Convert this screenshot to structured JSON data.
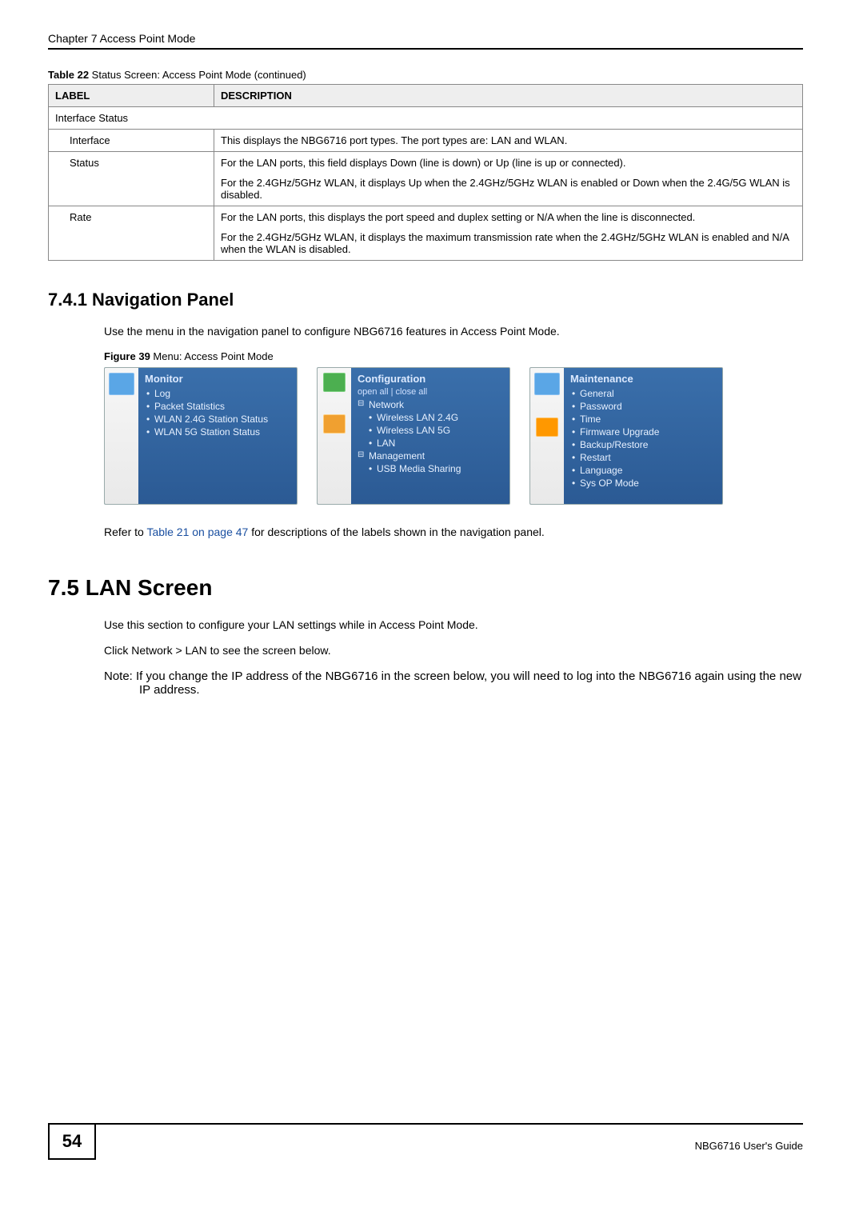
{
  "header": {
    "chapter": "Chapter 7 Access Point Mode"
  },
  "table": {
    "caption_prefix": "Table 22",
    "caption_rest": "   Status Screen: Access Point Mode (continued)",
    "col_label": "LABEL",
    "col_desc": "DESCRIPTION",
    "rows": {
      "interface_status": "Interface Status",
      "interface_label": "Interface",
      "interface_desc": "This displays the NBG6716 port types. The port types are: LAN and WLAN.",
      "status_label": "Status",
      "status_desc_p1": "For the LAN ports, this field displays Down (line is down) or Up (line is up or connected).",
      "status_desc_p2": "For the 2.4GHz/5GHz WLAN, it displays Up when the 2.4GHz/5GHz WLAN is enabled or Down when the 2.4G/5G WLAN is disabled.",
      "rate_label": "Rate",
      "rate_desc_p1": "For the LAN ports, this displays the port speed and duplex setting or N/A when the line is disconnected.",
      "rate_desc_p2": "For the 2.4GHz/5GHz WLAN, it displays the maximum transmission rate when the 2.4GHz/5GHz WLAN is enabled and N/A when the WLAN is disabled."
    }
  },
  "sections": {
    "nav_panel_heading": "7.4.1  Navigation Panel",
    "nav_panel_intro": "Use the menu in the navigation panel to configure NBG6716 features in Access Point Mode.",
    "figure_caption_prefix": "Figure 39",
    "figure_caption_rest": "   Menu: Access Point Mode",
    "refer_text_pre": "Refer to ",
    "refer_link": "Table 21 on page 47",
    "refer_text_post": " for descriptions of the labels shown in the navigation panel.",
    "lan_heading": "7.5  LAN Screen",
    "lan_intro": "Use this section to configure your LAN settings while in Access Point Mode.",
    "lan_click": "Click Network > LAN to see the screen below.",
    "lan_note": "Note: If you change the IP address of the NBG6716 in the screen below, you will need to log into the NBG6716 again using the new IP address."
  },
  "menus": {
    "monitor": {
      "title": "Monitor",
      "items": [
        "Log",
        "Packet Statistics",
        "WLAN 2.4G Station Status",
        "WLAN 5G Station Status"
      ]
    },
    "configuration": {
      "title": "Configuration",
      "sub": "open all  | close all",
      "network": "Network",
      "net_items": [
        "Wireless LAN 2.4G",
        "Wireless LAN 5G",
        "LAN"
      ],
      "management": "Management",
      "mgmt_items": [
        "USB Media Sharing"
      ]
    },
    "maintenance": {
      "title": "Maintenance",
      "items": [
        "General",
        "Password",
        "Time",
        "Firmware Upgrade",
        "Backup/Restore",
        "Restart",
        "Language",
        "Sys OP Mode"
      ]
    }
  },
  "footer": {
    "page": "54",
    "guide": "NBG6716 User's Guide"
  }
}
